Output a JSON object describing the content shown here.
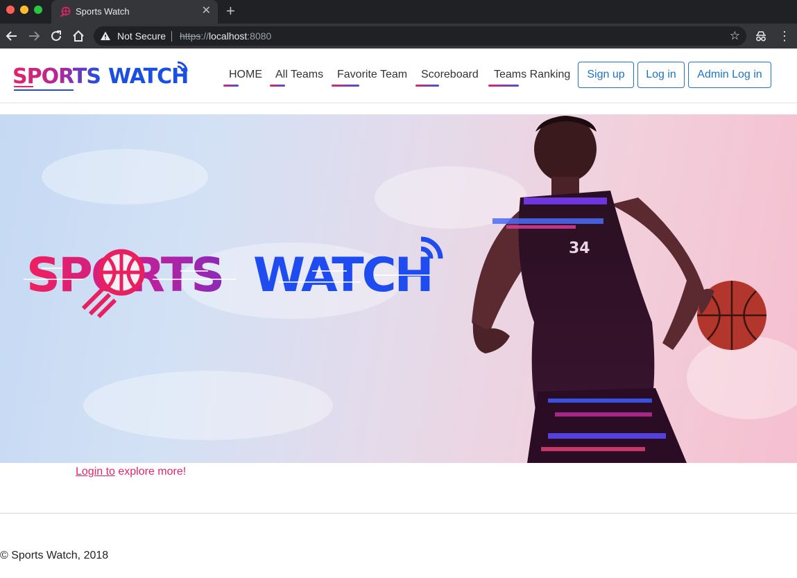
{
  "browser": {
    "tab_title": "Sports Watch",
    "new_tab_symbol": "+",
    "close_symbol": "✕",
    "security_label": "Not Secure",
    "url_scheme": "https",
    "url_separator": "://",
    "url_host": "localhost",
    "url_port": ":8080"
  },
  "brand": {
    "word1": "SPORTS",
    "word2": "WATCH",
    "accent_pink": "#e4236a",
    "accent_blue": "#1a4fe0"
  },
  "nav": {
    "items": [
      {
        "label": "HOME"
      },
      {
        "label": "All Teams"
      },
      {
        "label": "Favorite Team"
      },
      {
        "label": "Scoreboard"
      },
      {
        "label": "Teams Ranking"
      }
    ],
    "signup_label": "Sign up",
    "login_label": "Log in",
    "admin_login_label": "Admin Log in"
  },
  "hero": {
    "jersey_number": "34"
  },
  "cta": {
    "link_text": "Login to",
    "rest_text": " explore more!"
  },
  "footer": {
    "text": "© Sports Watch, 2018"
  },
  "icons": {
    "back": "back-arrow-icon",
    "forward": "forward-arrow-icon",
    "reload": "reload-icon",
    "home": "home-icon",
    "warning": "warning-icon",
    "bookmark": "star-icon",
    "incognito": "incognito-icon",
    "menu": "menu-dots-icon",
    "wifi": "signal-icon",
    "basketball": "basketball-icon"
  }
}
